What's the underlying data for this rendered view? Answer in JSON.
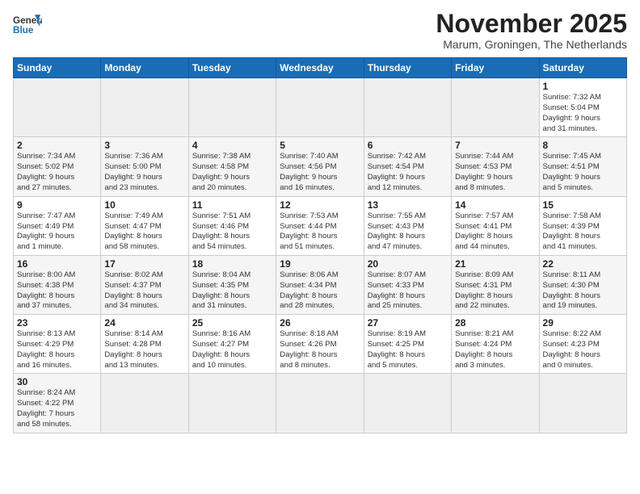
{
  "logo": {
    "line1": "General",
    "line2": "Blue"
  },
  "title": "November 2025",
  "subtitle": "Marum, Groningen, The Netherlands",
  "weekdays": [
    "Sunday",
    "Monday",
    "Tuesday",
    "Wednesday",
    "Thursday",
    "Friday",
    "Saturday"
  ],
  "days": [
    {
      "num": "",
      "info": ""
    },
    {
      "num": "",
      "info": ""
    },
    {
      "num": "",
      "info": ""
    },
    {
      "num": "",
      "info": ""
    },
    {
      "num": "",
      "info": ""
    },
    {
      "num": "",
      "info": ""
    },
    {
      "num": "1",
      "info": "Sunrise: 7:32 AM\nSunset: 5:04 PM\nDaylight: 9 hours\nand 31 minutes."
    },
    {
      "num": "2",
      "info": "Sunrise: 7:34 AM\nSunset: 5:02 PM\nDaylight: 9 hours\nand 27 minutes."
    },
    {
      "num": "3",
      "info": "Sunrise: 7:36 AM\nSunset: 5:00 PM\nDaylight: 9 hours\nand 23 minutes."
    },
    {
      "num": "4",
      "info": "Sunrise: 7:38 AM\nSunset: 4:58 PM\nDaylight: 9 hours\nand 20 minutes."
    },
    {
      "num": "5",
      "info": "Sunrise: 7:40 AM\nSunset: 4:56 PM\nDaylight: 9 hours\nand 16 minutes."
    },
    {
      "num": "6",
      "info": "Sunrise: 7:42 AM\nSunset: 4:54 PM\nDaylight: 9 hours\nand 12 minutes."
    },
    {
      "num": "7",
      "info": "Sunrise: 7:44 AM\nSunset: 4:53 PM\nDaylight: 9 hours\nand 8 minutes."
    },
    {
      "num": "8",
      "info": "Sunrise: 7:45 AM\nSunset: 4:51 PM\nDaylight: 9 hours\nand 5 minutes."
    },
    {
      "num": "9",
      "info": "Sunrise: 7:47 AM\nSunset: 4:49 PM\nDaylight: 9 hours\nand 1 minute."
    },
    {
      "num": "10",
      "info": "Sunrise: 7:49 AM\nSunset: 4:47 PM\nDaylight: 8 hours\nand 58 minutes."
    },
    {
      "num": "11",
      "info": "Sunrise: 7:51 AM\nSunset: 4:46 PM\nDaylight: 8 hours\nand 54 minutes."
    },
    {
      "num": "12",
      "info": "Sunrise: 7:53 AM\nSunset: 4:44 PM\nDaylight: 8 hours\nand 51 minutes."
    },
    {
      "num": "13",
      "info": "Sunrise: 7:55 AM\nSunset: 4:43 PM\nDaylight: 8 hours\nand 47 minutes."
    },
    {
      "num": "14",
      "info": "Sunrise: 7:57 AM\nSunset: 4:41 PM\nDaylight: 8 hours\nand 44 minutes."
    },
    {
      "num": "15",
      "info": "Sunrise: 7:58 AM\nSunset: 4:39 PM\nDaylight: 8 hours\nand 41 minutes."
    },
    {
      "num": "16",
      "info": "Sunrise: 8:00 AM\nSunset: 4:38 PM\nDaylight: 8 hours\nand 37 minutes."
    },
    {
      "num": "17",
      "info": "Sunrise: 8:02 AM\nSunset: 4:37 PM\nDaylight: 8 hours\nand 34 minutes."
    },
    {
      "num": "18",
      "info": "Sunrise: 8:04 AM\nSunset: 4:35 PM\nDaylight: 8 hours\nand 31 minutes."
    },
    {
      "num": "19",
      "info": "Sunrise: 8:06 AM\nSunset: 4:34 PM\nDaylight: 8 hours\nand 28 minutes."
    },
    {
      "num": "20",
      "info": "Sunrise: 8:07 AM\nSunset: 4:33 PM\nDaylight: 8 hours\nand 25 minutes."
    },
    {
      "num": "21",
      "info": "Sunrise: 8:09 AM\nSunset: 4:31 PM\nDaylight: 8 hours\nand 22 minutes."
    },
    {
      "num": "22",
      "info": "Sunrise: 8:11 AM\nSunset: 4:30 PM\nDaylight: 8 hours\nand 19 minutes."
    },
    {
      "num": "23",
      "info": "Sunrise: 8:13 AM\nSunset: 4:29 PM\nDaylight: 8 hours\nand 16 minutes."
    },
    {
      "num": "24",
      "info": "Sunrise: 8:14 AM\nSunset: 4:28 PM\nDaylight: 8 hours\nand 13 minutes."
    },
    {
      "num": "25",
      "info": "Sunrise: 8:16 AM\nSunset: 4:27 PM\nDaylight: 8 hours\nand 10 minutes."
    },
    {
      "num": "26",
      "info": "Sunrise: 8:18 AM\nSunset: 4:26 PM\nDaylight: 8 hours\nand 8 minutes."
    },
    {
      "num": "27",
      "info": "Sunrise: 8:19 AM\nSunset: 4:25 PM\nDaylight: 8 hours\nand 5 minutes."
    },
    {
      "num": "28",
      "info": "Sunrise: 8:21 AM\nSunset: 4:24 PM\nDaylight: 8 hours\nand 3 minutes."
    },
    {
      "num": "29",
      "info": "Sunrise: 8:22 AM\nSunset: 4:23 PM\nDaylight: 8 hours\nand 0 minutes."
    },
    {
      "num": "30",
      "info": "Sunrise: 8:24 AM\nSunset: 4:22 PM\nDaylight: 7 hours\nand 58 minutes."
    },
    {
      "num": "",
      "info": ""
    },
    {
      "num": "",
      "info": ""
    },
    {
      "num": "",
      "info": ""
    },
    {
      "num": "",
      "info": ""
    },
    {
      "num": "",
      "info": ""
    },
    {
      "num": "",
      "info": ""
    }
  ]
}
